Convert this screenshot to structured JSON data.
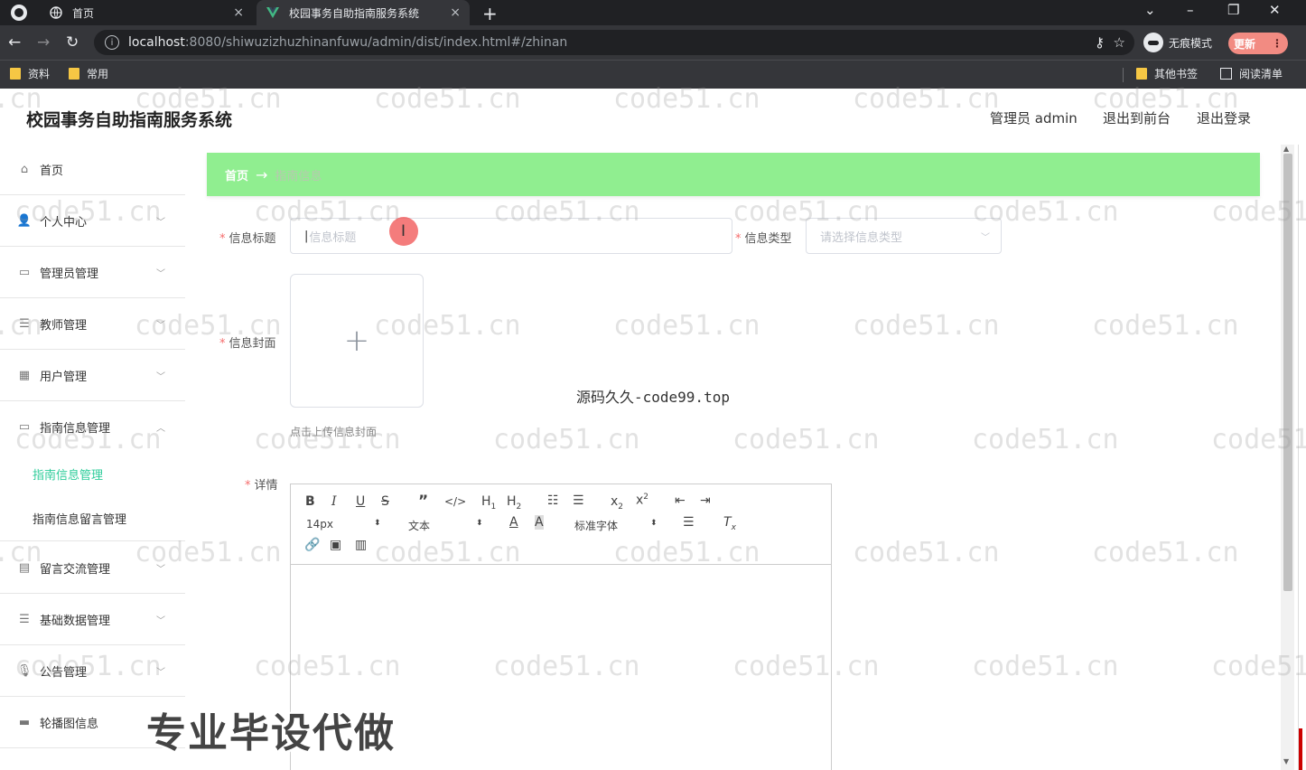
{
  "browser": {
    "tabs": [
      {
        "title": "首页",
        "close": "×"
      },
      {
        "title": "校园事务自助指南服务系统",
        "close": "×"
      }
    ],
    "new_tab": "+",
    "url_host": "localhost",
    "url_rest": ":8080/shiwuzizhuzhinanfuwu/admin/dist/index.html#/zhinan",
    "incognito_label": "无痕模式",
    "update_label": "更新",
    "bookmarks": [
      "资料",
      "常用"
    ],
    "bookmarks_right": [
      "其他书签",
      "阅读清单"
    ]
  },
  "header": {
    "title": "校园事务自助指南服务系统",
    "admin": "管理员 admin",
    "to_front": "退出到前台",
    "logout": "退出登录"
  },
  "sidebar": {
    "items": [
      {
        "label": "首页",
        "icon": "home-icon"
      },
      {
        "label": "个人中心",
        "icon": "user-icon"
      },
      {
        "label": "管理员管理",
        "icon": "admin-icon"
      },
      {
        "label": "教师管理",
        "icon": "teacher-icon"
      },
      {
        "label": "用户管理",
        "icon": "grid-icon"
      },
      {
        "label": "指南信息管理",
        "icon": "guide-icon"
      },
      {
        "label": "留言交流管理",
        "icon": "message-icon"
      },
      {
        "label": "基础数据管理",
        "icon": "list-icon"
      },
      {
        "label": "公告管理",
        "icon": "mic-icon"
      },
      {
        "label": "轮播图信息",
        "icon": "monitor-icon"
      }
    ],
    "sub_items": [
      "指南信息管理",
      "指南信息留言管理"
    ]
  },
  "breadcrumb": {
    "home": "首页",
    "arrow": "→",
    "current": "指南信息"
  },
  "form": {
    "title_label": "信息标题",
    "title_placeholder": "信息标题",
    "type_label": "信息类型",
    "type_placeholder": "请选择信息类型",
    "cover_label": "信息封面",
    "cover_tip": "点击上传信息封面",
    "detail_label": "详情",
    "required_mark": "*"
  },
  "editor": {
    "font_size": "14px",
    "block_type": "文本",
    "font_family": "标准字体"
  },
  "overlay": {
    "watermark": "code51.cn",
    "center_text": "源码久久-code99.top",
    "stamp": "专业毕设代做"
  }
}
